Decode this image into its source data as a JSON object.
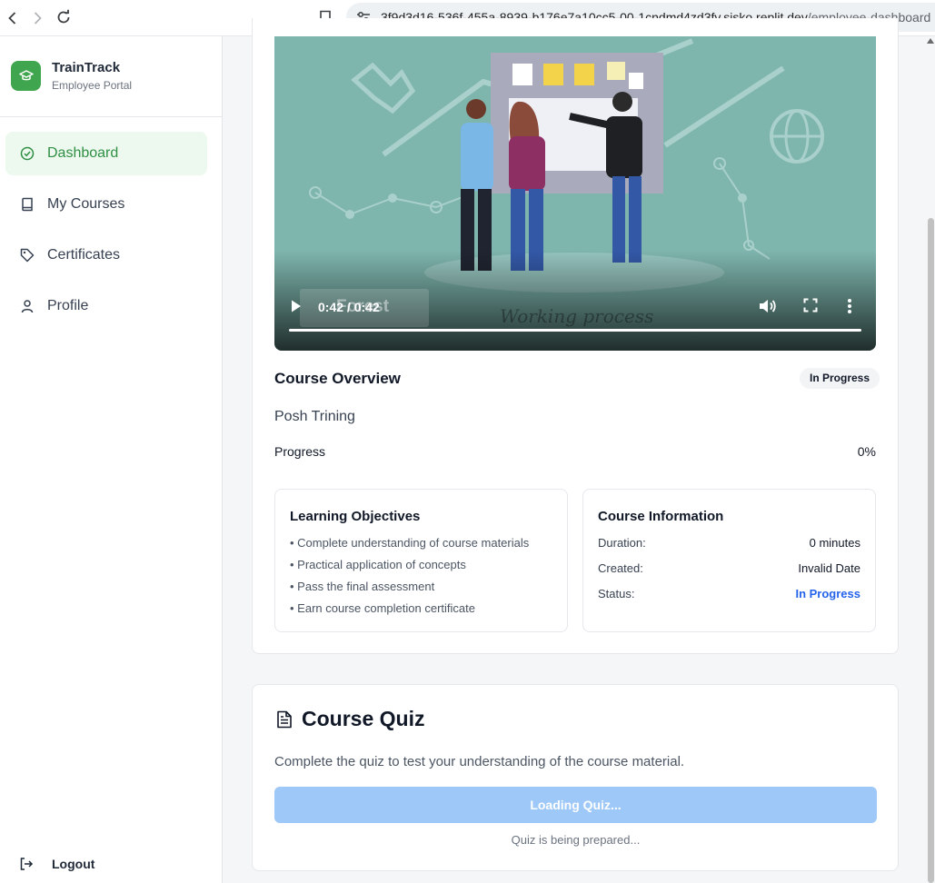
{
  "browser": {
    "url_host": "3f9d3d16-536f-455a-8939-b176e7a10cc5-00-1cndmd4zd3fv.sisko.replit.dev",
    "url_path": "/employee-dashboard"
  },
  "sidebar": {
    "brand_name": "TrainTrack",
    "brand_subtitle": "Employee Portal",
    "items": [
      {
        "label": "Dashboard",
        "icon": "check-circle-icon",
        "active": true
      },
      {
        "label": "My Courses",
        "icon": "book-icon",
        "active": false
      },
      {
        "label": "Certificates",
        "icon": "tag-icon",
        "active": false
      },
      {
        "label": "Profile",
        "icon": "user-icon",
        "active": false
      }
    ],
    "logout_label": "Logout"
  },
  "video": {
    "time_display": "0:42 / 0:42",
    "played_fraction": 1.0,
    "watermark_text": "Forest",
    "caption_text": "Working process"
  },
  "overview": {
    "title": "Course Overview",
    "status_badge": "In Progress",
    "course_name": "Posh Trining",
    "progress_label": "Progress",
    "progress_value": "0%"
  },
  "objectives": {
    "title": "Learning Objectives",
    "items": [
      "• Complete understanding of course materials",
      "• Practical application of concepts",
      "• Pass the final assessment",
      "• Earn course completion certificate"
    ]
  },
  "course_info": {
    "title": "Course Information",
    "rows": [
      {
        "label": "Duration:",
        "value": "0 minutes"
      },
      {
        "label": "Created:",
        "value": "Invalid Date"
      },
      {
        "label": "Status:",
        "value": "In Progress"
      }
    ]
  },
  "quiz": {
    "title": "Course Quiz",
    "description": "Complete the quiz to test your understanding of the course material.",
    "button_label": "Loading Quiz...",
    "note": "Quiz is being prepared..."
  },
  "colors": {
    "brand_green": "#3fa64f",
    "active_nav_bg": "#edf9ef",
    "status_blue": "#2563eb",
    "quiz_button": "#9dc8f7",
    "video_bg": "#7eb5ad"
  }
}
